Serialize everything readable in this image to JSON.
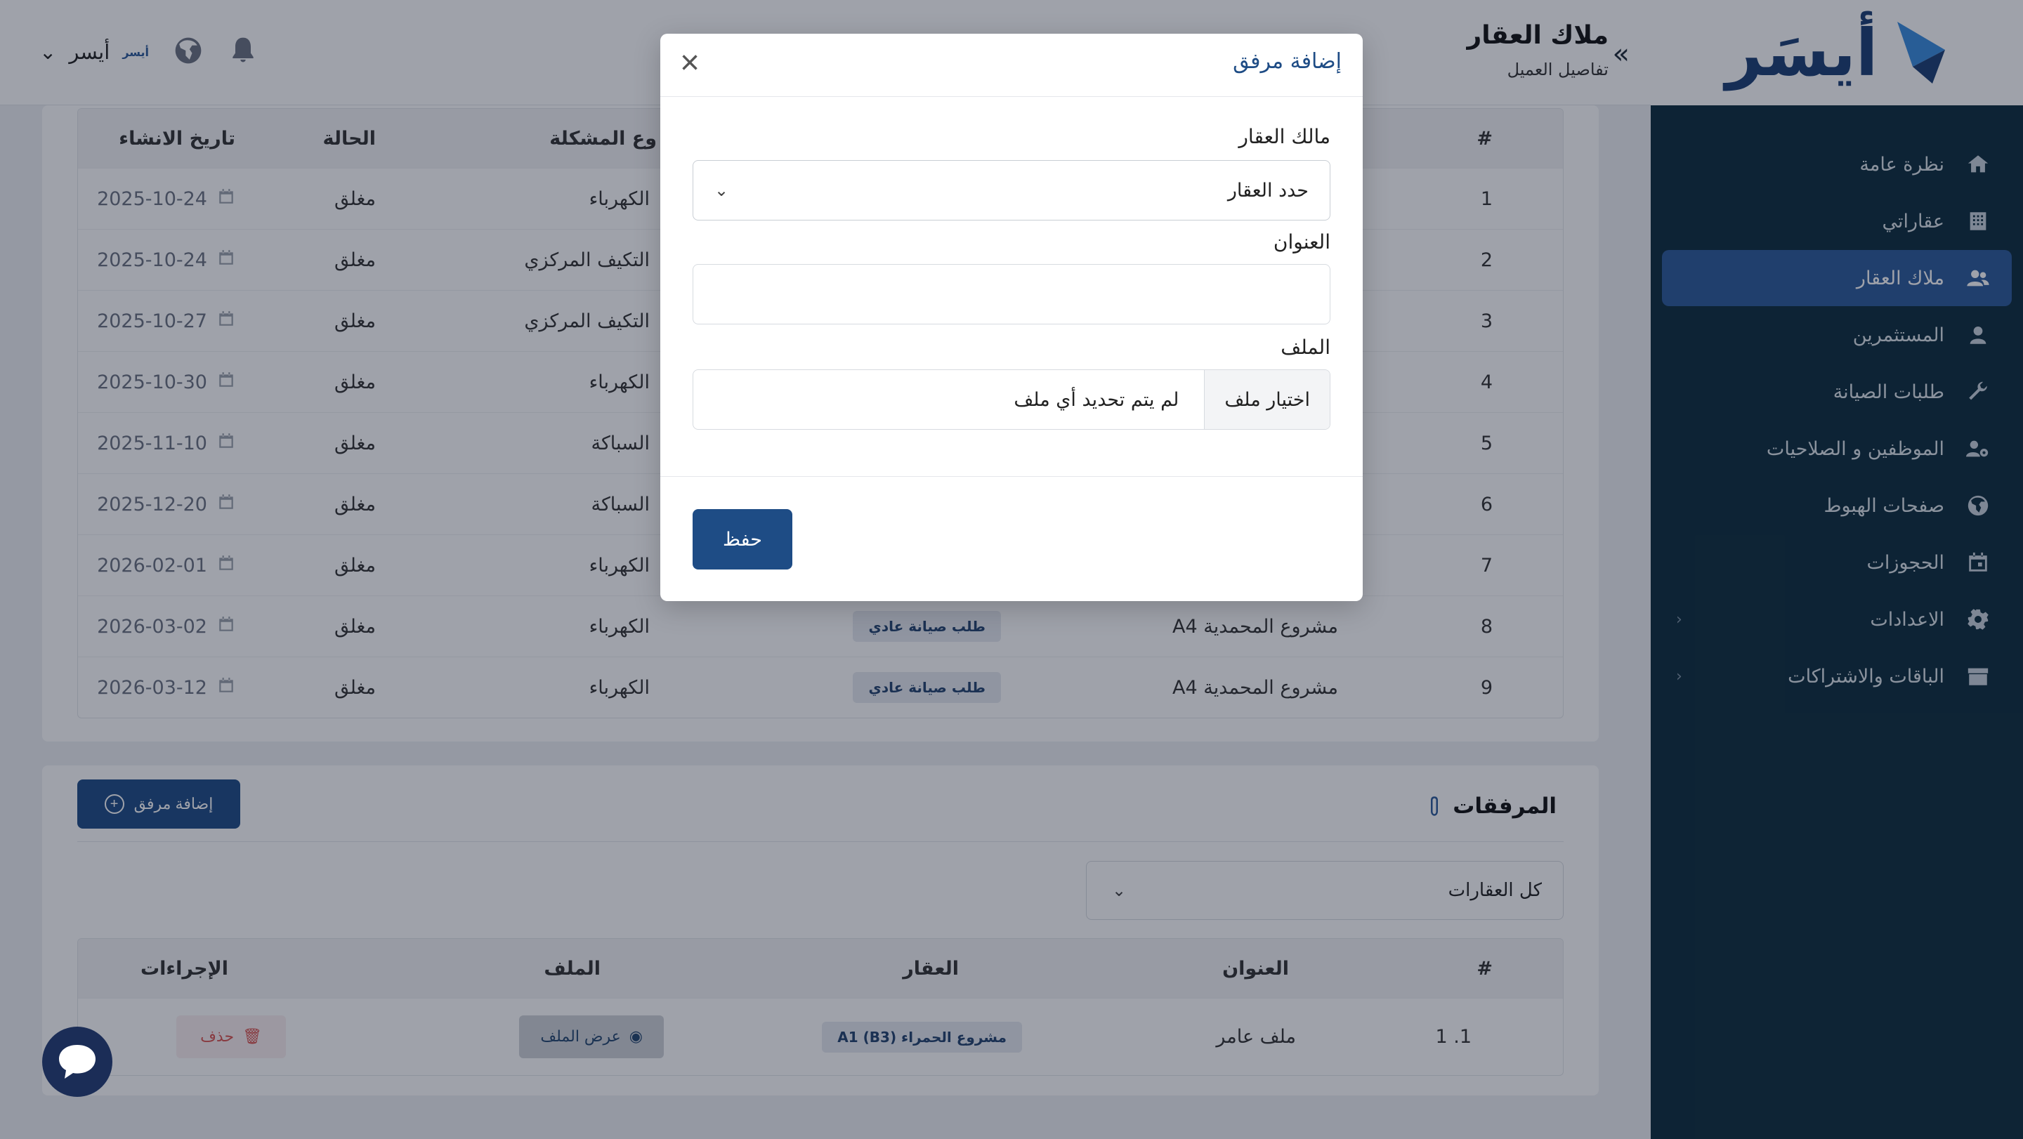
{
  "brand": {
    "logo_text": "أيسَر",
    "mini_logo": "أيسر"
  },
  "header": {
    "title": "ملاك العقار",
    "subtitle": "تفاصيل العميل",
    "user_name": "أيسر"
  },
  "sidebar": {
    "items": [
      {
        "label": "نظرة عامة",
        "icon": "home-icon"
      },
      {
        "label": "عقاراتي",
        "icon": "building-icon"
      },
      {
        "label": "ملاك العقار",
        "icon": "users-icon",
        "active": true
      },
      {
        "label": "المستثمرين",
        "icon": "user-icon"
      },
      {
        "label": "طلبات الصيانة",
        "icon": "wrench-icon"
      },
      {
        "label": "الموظفين و الصلاحيات",
        "icon": "users-gear-icon"
      },
      {
        "label": "صفحات الهبوط",
        "icon": "globe-icon"
      },
      {
        "label": "الحجوزات",
        "icon": "calendar-icon"
      },
      {
        "label": "الاعدادات",
        "icon": "gear-icon",
        "has_children": true
      },
      {
        "label": "الباقات والاشتراكات",
        "icon": "package-icon",
        "has_children": true
      }
    ]
  },
  "tickets": {
    "columns": {
      "index": "#",
      "type": "وع المشكلة",
      "status": "الحالة",
      "created": "تاريخ الانشاء"
    },
    "rows": [
      {
        "index": "1",
        "property": "",
        "badge": "",
        "type": "الكهرباء",
        "status": "مغلق",
        "date": "2025-10-24"
      },
      {
        "index": "2",
        "property": "",
        "badge": "",
        "type": "التكيف المركزي",
        "status": "مغلق",
        "date": "2025-10-24"
      },
      {
        "index": "3",
        "property": "",
        "badge": "",
        "type": "التكيف المركزي",
        "status": "مغلق",
        "date": "2025-10-27"
      },
      {
        "index": "4",
        "property": "",
        "badge": "",
        "type": "الكهرباء",
        "status": "مغلق",
        "date": "2025-10-30"
      },
      {
        "index": "5",
        "property": "",
        "badge": "",
        "type": "السباكة",
        "status": "مغلق",
        "date": "2025-11-10"
      },
      {
        "index": "6",
        "property": "",
        "badge": "",
        "type": "السباكة",
        "status": "مغلق",
        "date": "2025-12-20"
      },
      {
        "index": "7",
        "property": "",
        "badge": "",
        "type": "الكهرباء",
        "status": "مغلق",
        "date": "2026-02-01"
      },
      {
        "index": "8",
        "property": "مشروع المحمدية A4",
        "badge": "طلب صيانة عادي",
        "type": "الكهرباء",
        "status": "مغلق",
        "date": "2026-03-02"
      },
      {
        "index": "9",
        "property": "مشروع المحمدية A4",
        "badge": "طلب صيانة عادي",
        "type": "الكهرباء",
        "status": "مغلق",
        "date": "2026-03-12"
      }
    ]
  },
  "attachments": {
    "title": "المرفقات",
    "add_button": "إضافة مرفق",
    "filter_value": "كل العقارات",
    "columns": {
      "index": "#",
      "title": "العنوان",
      "property": "العقار",
      "file": "الملف",
      "actions": "الإجراءات"
    },
    "rows": [
      {
        "index": "1. 1",
        "title": "ملف عامر",
        "property": "مشروع الحمراء (A1 (B3",
        "view_label": "عرض الملف",
        "delete_label": "حذف"
      }
    ]
  },
  "modal": {
    "title": "إضافة مرفق",
    "owner_label": "مالك العقار",
    "owner_select_value": "حدد العقار",
    "title_label": "العنوان",
    "title_value": "",
    "file_label": "الملف",
    "file_button": "اختيار ملف",
    "file_status": "لم يتم تحديد أي ملف",
    "save_label": "حفظ"
  },
  "colors": {
    "primary": "#1e4c85",
    "sidebar_bg": "#0d2c3c",
    "sidebar_active": "#2c5a99",
    "danger": "#d9534f"
  }
}
